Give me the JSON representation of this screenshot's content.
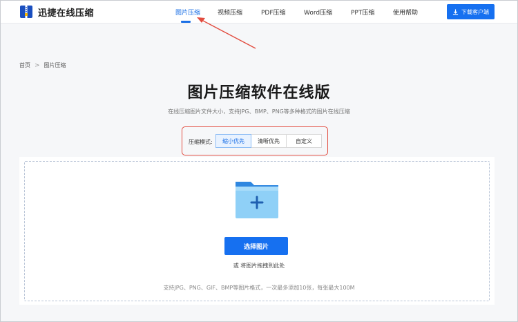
{
  "brand": {
    "name": "迅捷在线压缩"
  },
  "nav": {
    "items": [
      {
        "label": "图片压缩",
        "active": true
      },
      {
        "label": "视频压缩"
      },
      {
        "label": "PDF压缩"
      },
      {
        "label": "Word压缩"
      },
      {
        "label": "PPT压缩"
      },
      {
        "label": "使用帮助"
      }
    ],
    "download_label": "下载客户端",
    "download_icon": "download-icon"
  },
  "breadcrumb": {
    "home": "首页",
    "separator": ">",
    "current": "图片压缩"
  },
  "page": {
    "title": "图片压缩软件在线版",
    "subtitle": "在线压缩图片文件大小，支持JPG、BMP、PNG等多种格式的图片在线压缩"
  },
  "mode": {
    "label": "压缩模式:",
    "options": [
      "缩小优先",
      "清晰优先",
      "自定义"
    ],
    "selected": "缩小优先"
  },
  "upload": {
    "folder_icon": "folder-plus-icon",
    "button_label": "选择图片",
    "drag_hint": "或 将图片拖拽到此处",
    "format_note": "支持JPG、PNG、GIF、BMP等图片格式，一次最多添加10张，每张最大100M"
  },
  "colors": {
    "accent": "#1670f0",
    "annotation": "#e24c3f",
    "folder_light": "#8fd0f7",
    "folder_dark": "#2f87e0"
  }
}
